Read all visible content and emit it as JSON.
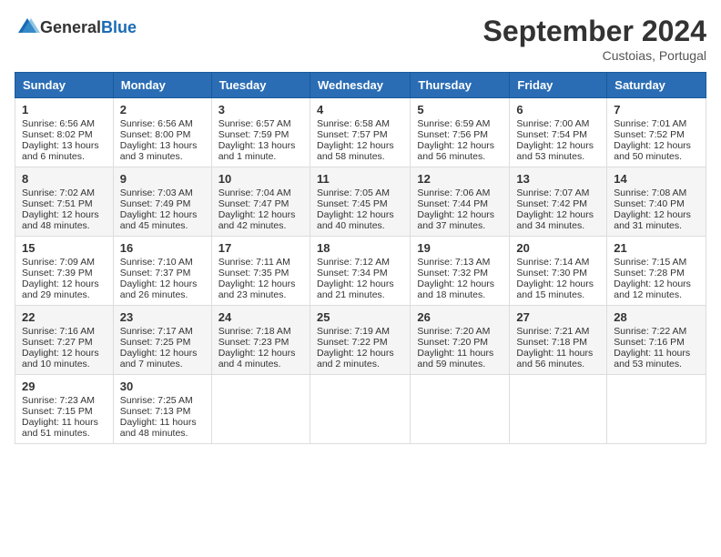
{
  "header": {
    "logo_general": "General",
    "logo_blue": "Blue",
    "month_title": "September 2024",
    "location": "Custoias, Portugal"
  },
  "weekdays": [
    "Sunday",
    "Monday",
    "Tuesday",
    "Wednesday",
    "Thursday",
    "Friday",
    "Saturday"
  ],
  "weeks": [
    [
      {
        "day": "1",
        "lines": [
          "Sunrise: 6:56 AM",
          "Sunset: 8:02 PM",
          "Daylight: 13 hours",
          "and 6 minutes."
        ]
      },
      {
        "day": "2",
        "lines": [
          "Sunrise: 6:56 AM",
          "Sunset: 8:00 PM",
          "Daylight: 13 hours",
          "and 3 minutes."
        ]
      },
      {
        "day": "3",
        "lines": [
          "Sunrise: 6:57 AM",
          "Sunset: 7:59 PM",
          "Daylight: 13 hours",
          "and 1 minute."
        ]
      },
      {
        "day": "4",
        "lines": [
          "Sunrise: 6:58 AM",
          "Sunset: 7:57 PM",
          "Daylight: 12 hours",
          "and 58 minutes."
        ]
      },
      {
        "day": "5",
        "lines": [
          "Sunrise: 6:59 AM",
          "Sunset: 7:56 PM",
          "Daylight: 12 hours",
          "and 56 minutes."
        ]
      },
      {
        "day": "6",
        "lines": [
          "Sunrise: 7:00 AM",
          "Sunset: 7:54 PM",
          "Daylight: 12 hours",
          "and 53 minutes."
        ]
      },
      {
        "day": "7",
        "lines": [
          "Sunrise: 7:01 AM",
          "Sunset: 7:52 PM",
          "Daylight: 12 hours",
          "and 50 minutes."
        ]
      }
    ],
    [
      {
        "day": "8",
        "lines": [
          "Sunrise: 7:02 AM",
          "Sunset: 7:51 PM",
          "Daylight: 12 hours",
          "and 48 minutes."
        ]
      },
      {
        "day": "9",
        "lines": [
          "Sunrise: 7:03 AM",
          "Sunset: 7:49 PM",
          "Daylight: 12 hours",
          "and 45 minutes."
        ]
      },
      {
        "day": "10",
        "lines": [
          "Sunrise: 7:04 AM",
          "Sunset: 7:47 PM",
          "Daylight: 12 hours",
          "and 42 minutes."
        ]
      },
      {
        "day": "11",
        "lines": [
          "Sunrise: 7:05 AM",
          "Sunset: 7:45 PM",
          "Daylight: 12 hours",
          "and 40 minutes."
        ]
      },
      {
        "day": "12",
        "lines": [
          "Sunrise: 7:06 AM",
          "Sunset: 7:44 PM",
          "Daylight: 12 hours",
          "and 37 minutes."
        ]
      },
      {
        "day": "13",
        "lines": [
          "Sunrise: 7:07 AM",
          "Sunset: 7:42 PM",
          "Daylight: 12 hours",
          "and 34 minutes."
        ]
      },
      {
        "day": "14",
        "lines": [
          "Sunrise: 7:08 AM",
          "Sunset: 7:40 PM",
          "Daylight: 12 hours",
          "and 31 minutes."
        ]
      }
    ],
    [
      {
        "day": "15",
        "lines": [
          "Sunrise: 7:09 AM",
          "Sunset: 7:39 PM",
          "Daylight: 12 hours",
          "and 29 minutes."
        ]
      },
      {
        "day": "16",
        "lines": [
          "Sunrise: 7:10 AM",
          "Sunset: 7:37 PM",
          "Daylight: 12 hours",
          "and 26 minutes."
        ]
      },
      {
        "day": "17",
        "lines": [
          "Sunrise: 7:11 AM",
          "Sunset: 7:35 PM",
          "Daylight: 12 hours",
          "and 23 minutes."
        ]
      },
      {
        "day": "18",
        "lines": [
          "Sunrise: 7:12 AM",
          "Sunset: 7:34 PM",
          "Daylight: 12 hours",
          "and 21 minutes."
        ]
      },
      {
        "day": "19",
        "lines": [
          "Sunrise: 7:13 AM",
          "Sunset: 7:32 PM",
          "Daylight: 12 hours",
          "and 18 minutes."
        ]
      },
      {
        "day": "20",
        "lines": [
          "Sunrise: 7:14 AM",
          "Sunset: 7:30 PM",
          "Daylight: 12 hours",
          "and 15 minutes."
        ]
      },
      {
        "day": "21",
        "lines": [
          "Sunrise: 7:15 AM",
          "Sunset: 7:28 PM",
          "Daylight: 12 hours",
          "and 12 minutes."
        ]
      }
    ],
    [
      {
        "day": "22",
        "lines": [
          "Sunrise: 7:16 AM",
          "Sunset: 7:27 PM",
          "Daylight: 12 hours",
          "and 10 minutes."
        ]
      },
      {
        "day": "23",
        "lines": [
          "Sunrise: 7:17 AM",
          "Sunset: 7:25 PM",
          "Daylight: 12 hours",
          "and 7 minutes."
        ]
      },
      {
        "day": "24",
        "lines": [
          "Sunrise: 7:18 AM",
          "Sunset: 7:23 PM",
          "Daylight: 12 hours",
          "and 4 minutes."
        ]
      },
      {
        "day": "25",
        "lines": [
          "Sunrise: 7:19 AM",
          "Sunset: 7:22 PM",
          "Daylight: 12 hours",
          "and 2 minutes."
        ]
      },
      {
        "day": "26",
        "lines": [
          "Sunrise: 7:20 AM",
          "Sunset: 7:20 PM",
          "Daylight: 11 hours",
          "and 59 minutes."
        ]
      },
      {
        "day": "27",
        "lines": [
          "Sunrise: 7:21 AM",
          "Sunset: 7:18 PM",
          "Daylight: 11 hours",
          "and 56 minutes."
        ]
      },
      {
        "day": "28",
        "lines": [
          "Sunrise: 7:22 AM",
          "Sunset: 7:16 PM",
          "Daylight: 11 hours",
          "and 53 minutes."
        ]
      }
    ],
    [
      {
        "day": "29",
        "lines": [
          "Sunrise: 7:23 AM",
          "Sunset: 7:15 PM",
          "Daylight: 11 hours",
          "and 51 minutes."
        ]
      },
      {
        "day": "30",
        "lines": [
          "Sunrise: 7:25 AM",
          "Sunset: 7:13 PM",
          "Daylight: 11 hours",
          "and 48 minutes."
        ]
      },
      {
        "day": "",
        "lines": []
      },
      {
        "day": "",
        "lines": []
      },
      {
        "day": "",
        "lines": []
      },
      {
        "day": "",
        "lines": []
      },
      {
        "day": "",
        "lines": []
      }
    ]
  ]
}
